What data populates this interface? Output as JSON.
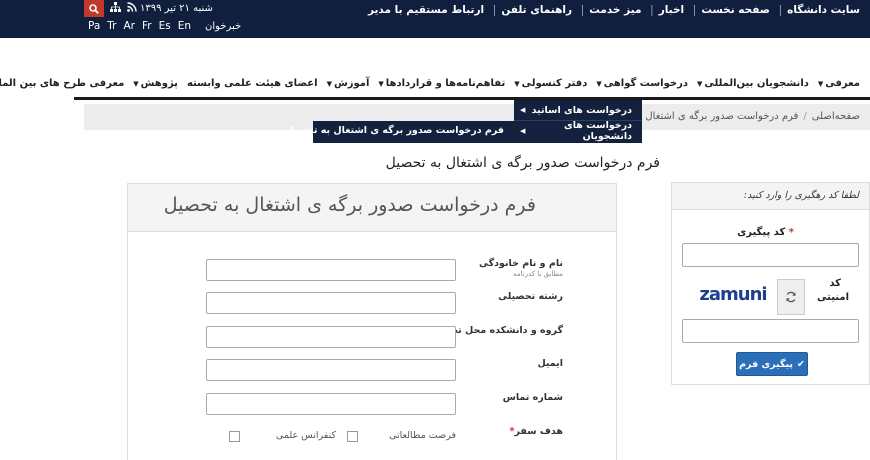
{
  "topbar": {
    "links": [
      "سایت دانشگاه",
      "صفحه نخست",
      "اخبار",
      "میز خدمت",
      "راهنمای تلفن",
      "ارتباط مستقیم با مدیر"
    ],
    "date": "شنبه ۲۱ تیر ۱۳۹۹",
    "languages": [
      "Pa",
      "Tr",
      "Ar",
      "Fr",
      "Es",
      "En"
    ],
    "news_label": "خبرخوان"
  },
  "nav": {
    "items": [
      {
        "label": "معرفی",
        "caret": true
      },
      {
        "label": "دانشجویان بین‌المللی",
        "caret": true
      },
      {
        "label": "درخواست گواهی",
        "caret": true
      },
      {
        "label": "دفتر کنسولی",
        "caret": true
      },
      {
        "label": "تفاهم‌نامه‌ها و قراردادها",
        "caret": true
      },
      {
        "label": "آموزش",
        "caret": true
      },
      {
        "label": "اعضای هیئت علمی وابسته",
        "caret": false
      },
      {
        "label": "پژوهش",
        "caret": true
      },
      {
        "label": "معرفی طرح های بین المللی",
        "caret": false
      }
    ],
    "dropdown": {
      "item1": "درخواست های اساتید",
      "item2": "درخواست های دانشجویان",
      "submenu": "فرم درخواست صدور برگه ی اشتغال به تحصیل"
    }
  },
  "breadcrumb": {
    "home": "صفحه‌اصلی",
    "current": "فرم درخواست صدور برگه ی اشتغال به تح"
  },
  "page_title": "فرم درخواست صدور برگه ی اشتغال به تحصیل",
  "form": {
    "header": "فرم درخواست صدور برگه ی اشتغال به تحصیل",
    "fields": {
      "name": {
        "label": "نام و نام خانودگی",
        "sub": "مطابق با کدرنامه"
      },
      "major": {
        "label": "رشته تحصیلی"
      },
      "group": {
        "label": "گروه و دانشکده محل تحصیل"
      },
      "email": {
        "label": "ایمیل"
      },
      "phone": {
        "label": "شماره تماس"
      },
      "purpose": {
        "label": "هدف سفر",
        "required_mark": "*"
      }
    },
    "options": {
      "study": "فرصت مطالعاتی",
      "conference": "کنفرانس علمی"
    }
  },
  "track": {
    "prompt": "لطفا کد رهگیری را وارد کنید:",
    "code_label": "کد پیگیری",
    "required_mark": "*",
    "security_label_1": "کد",
    "security_label_2": "امنیتی",
    "captcha": "zamuni",
    "submit": "پیگیری فرم"
  }
}
